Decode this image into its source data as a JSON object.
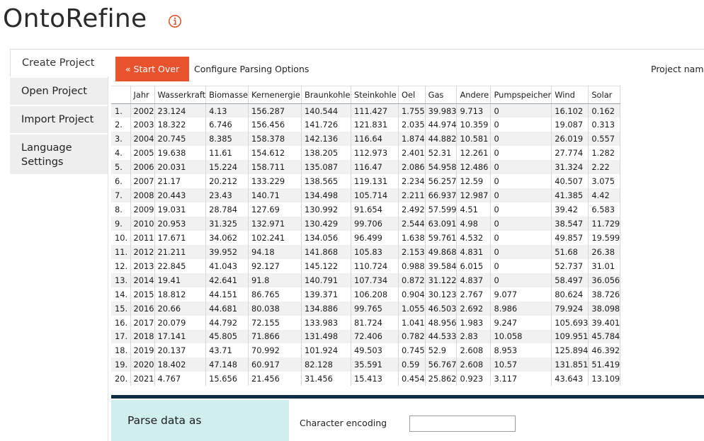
{
  "app": {
    "title": "OntoRefine",
    "info_icon": "info-circle-icon",
    "accent_color": "#e8532e"
  },
  "sidebar": {
    "items": [
      {
        "label": "Create Project",
        "active": true
      },
      {
        "label": "Open Project"
      },
      {
        "label": "Import Project"
      },
      {
        "label": "Language Settings"
      }
    ]
  },
  "toolbar": {
    "start_over_label": "« Start Over",
    "configure_label": "Configure Parsing Options",
    "project_name_label": "Project name"
  },
  "preview": {
    "columns": [
      "",
      "Jahr",
      "Wasserkraft",
      "Biomasse",
      "Kernenergie",
      "Braunkohle",
      "Steinkohle",
      "Oel",
      "Gas",
      "Andere",
      "Pumpspeicher",
      "Wind",
      "Solar"
    ],
    "rows": [
      [
        "1.",
        "2002",
        "23.124",
        "4.13",
        "156.287",
        "140.544",
        "111.427",
        "1.755",
        "39.983",
        "9.713",
        "0",
        "16.102",
        "0.162"
      ],
      [
        "2.",
        "2003",
        "18.322",
        "6.746",
        "156.456",
        "141.726",
        "121.831",
        "2.035",
        "44.974",
        "10.359",
        "0",
        "19.087",
        "0.313"
      ],
      [
        "3.",
        "2004",
        "20.745",
        "8.385",
        "158.378",
        "142.136",
        "116.64",
        "1.874",
        "44.882",
        "10.581",
        "0",
        "26.019",
        "0.557"
      ],
      [
        "4.",
        "2005",
        "19.638",
        "11.61",
        "154.612",
        "138.205",
        "112.973",
        "2.401",
        "52.31",
        "12.261",
        "0",
        "27.774",
        "1.282"
      ],
      [
        "5.",
        "2006",
        "20.031",
        "15.224",
        "158.711",
        "135.087",
        "116.47",
        "2.086",
        "54.958",
        "12.486",
        "0",
        "31.324",
        "2.22"
      ],
      [
        "6.",
        "2007",
        "21.17",
        "20.212",
        "133.229",
        "138.565",
        "119.131",
        "2.234",
        "56.257",
        "12.59",
        "0",
        "40.507",
        "3.075"
      ],
      [
        "7.",
        "2008",
        "20.443",
        "23.43",
        "140.71",
        "134.498",
        "105.714",
        "2.211",
        "66.937",
        "12.987",
        "0",
        "41.385",
        "4.42"
      ],
      [
        "8.",
        "2009",
        "19.031",
        "28.784",
        "127.69",
        "130.992",
        "91.654",
        "2.492",
        "57.599",
        "4.51",
        "0",
        "39.42",
        "6.583"
      ],
      [
        "9.",
        "2010",
        "20.953",
        "31.325",
        "132.971",
        "130.429",
        "99.706",
        "2.544",
        "63.091",
        "4.98",
        "0",
        "38.547",
        "11.729"
      ],
      [
        "10.",
        "2011",
        "17.671",
        "34.062",
        "102.241",
        "134.056",
        "96.499",
        "1.638",
        "59.761",
        "4.532",
        "0",
        "49.857",
        "19.599"
      ],
      [
        "11.",
        "2012",
        "21.211",
        "39.952",
        "94.18",
        "141.868",
        "105.83",
        "2.153",
        "49.868",
        "4.831",
        "0",
        "51.68",
        "26.38"
      ],
      [
        "12.",
        "2013",
        "22.845",
        "41.043",
        "92.127",
        "145.122",
        "110.724",
        "0.988",
        "39.584",
        "6.015",
        "0",
        "52.737",
        "31.01"
      ],
      [
        "13.",
        "2014",
        "19.41",
        "42.641",
        "91.8",
        "140.791",
        "107.734",
        "0.872",
        "31.122",
        "4.837",
        "0",
        "58.497",
        "36.056"
      ],
      [
        "14.",
        "2015",
        "18.812",
        "44.151",
        "86.765",
        "139.371",
        "106.208",
        "0.904",
        "30.123",
        "2.767",
        "9.077",
        "80.624",
        "38.726"
      ],
      [
        "15.",
        "2016",
        "20.66",
        "44.681",
        "80.038",
        "134.886",
        "99.765",
        "1.055",
        "46.503",
        "2.692",
        "8.986",
        "79.924",
        "38.098"
      ],
      [
        "16.",
        "2017",
        "20.079",
        "44.792",
        "72.155",
        "133.983",
        "81.724",
        "1.041",
        "48.956",
        "1.983",
        "9.247",
        "105.693",
        "39.401"
      ],
      [
        "17.",
        "2018",
        "17.141",
        "45.805",
        "71.866",
        "131.498",
        "72.406",
        "0.782",
        "44.533",
        "2.83",
        "10.058",
        "109.951",
        "45.784"
      ],
      [
        "18.",
        "2019",
        "20.137",
        "43.71",
        "70.992",
        "101.924",
        "49.503",
        "0.745",
        "52.9",
        "2.608",
        "8.953",
        "125.894",
        "46.392"
      ],
      [
        "19.",
        "2020",
        "18.402",
        "47.148",
        "60.917",
        "82.128",
        "35.591",
        "0.59",
        "56.767",
        "2.608",
        "10.57",
        "131.851",
        "51.419"
      ],
      [
        "20.",
        "2021",
        "4.767",
        "15.656",
        "21.456",
        "31.456",
        "15.413",
        "0.454",
        "25.862",
        "0.923",
        "3.117",
        "43.643",
        "13.109"
      ]
    ]
  },
  "parse": {
    "title": "Parse data as",
    "encoding_label": "Character encoding",
    "encoding_value": ""
  }
}
